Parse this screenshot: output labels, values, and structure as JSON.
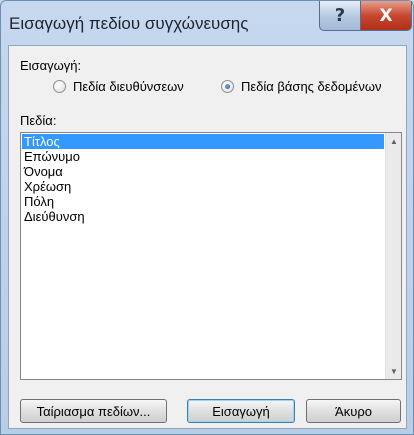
{
  "window": {
    "title": "Εισαγωγή πεδίου συγχώνευσης",
    "help_glyph": "?",
    "close_glyph": "X"
  },
  "insert_group": {
    "label": "Εισαγωγή:",
    "options": [
      {
        "label": "Πεδία διευθύνσεων",
        "selected": false
      },
      {
        "label": "Πεδία βάσης δεδομένων",
        "selected": true
      }
    ]
  },
  "fields": {
    "label": "Πεδία:",
    "items": [
      "Τίτλος",
      "Επώνυμο",
      "Όνομα",
      "Χρέωση",
      "Πόλη",
      "Διεύθυνση"
    ],
    "selected_index": 0
  },
  "buttons": {
    "match": "Ταίριασμα πεδίων...",
    "insert": "Εισαγωγή",
    "cancel": "Άκυρο"
  }
}
